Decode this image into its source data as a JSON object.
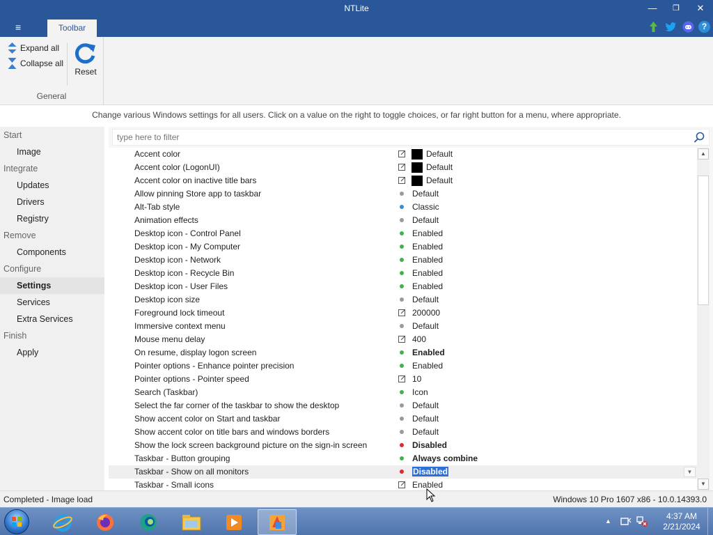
{
  "window": {
    "title": "NTLite",
    "minimize": "—",
    "restore": "❐",
    "close": "✕"
  },
  "ribbon": {
    "menu_icon": "≡",
    "tab_label": "Toolbar",
    "expand_all": "Expand all",
    "collapse_all": "Collapse all",
    "reset": "Reset",
    "group_label": "General",
    "header_icons": [
      "update-arrow-icon",
      "twitter-icon",
      "discord-icon",
      "help-icon"
    ],
    "help": "?"
  },
  "info_text": "Change various Windows settings for all users. Click on a value on the right to toggle choices, or far right button for a menu, where appropriate.",
  "sidebar": {
    "items": [
      {
        "label": "Start",
        "kind": "cat"
      },
      {
        "label": "Image",
        "kind": "sub"
      },
      {
        "label": "Integrate",
        "kind": "cat"
      },
      {
        "label": "Updates",
        "kind": "sub"
      },
      {
        "label": "Drivers",
        "kind": "sub"
      },
      {
        "label": "Registry",
        "kind": "sub"
      },
      {
        "label": "Remove",
        "kind": "cat"
      },
      {
        "label": "Components",
        "kind": "sub"
      },
      {
        "label": "Configure",
        "kind": "cat"
      },
      {
        "label": "Settings",
        "kind": "sub",
        "active": true
      },
      {
        "label": "Services",
        "kind": "sub"
      },
      {
        "label": "Extra Services",
        "kind": "sub"
      },
      {
        "label": "Finish",
        "kind": "cat"
      },
      {
        "label": "Apply",
        "kind": "sub"
      }
    ]
  },
  "filter": {
    "placeholder": "type here to filter"
  },
  "settings": [
    {
      "name": "Accent color",
      "indicator": "edit",
      "swatch": true,
      "value": "Default"
    },
    {
      "name": "Accent color (LogonUI)",
      "indicator": "edit",
      "swatch": true,
      "value": "Default"
    },
    {
      "name": "Accent color on inactive title bars",
      "indicator": "edit",
      "swatch": true,
      "value": "Default"
    },
    {
      "name": "Allow pinning Store app to taskbar",
      "indicator": "gray",
      "value": "Default"
    },
    {
      "name": "Alt-Tab style",
      "indicator": "blue",
      "value": "Classic"
    },
    {
      "name": "Animation effects",
      "indicator": "gray",
      "value": "Default"
    },
    {
      "name": "Desktop icon - Control Panel",
      "indicator": "green",
      "value": "Enabled"
    },
    {
      "name": "Desktop icon - My Computer",
      "indicator": "green",
      "value": "Enabled"
    },
    {
      "name": "Desktop icon - Network",
      "indicator": "green",
      "value": "Enabled"
    },
    {
      "name": "Desktop icon - Recycle Bin",
      "indicator": "green",
      "value": "Enabled"
    },
    {
      "name": "Desktop icon - User Files",
      "indicator": "green",
      "value": "Enabled"
    },
    {
      "name": "Desktop icon size",
      "indicator": "gray",
      "value": "Default"
    },
    {
      "name": "Foreground lock timeout",
      "indicator": "edit",
      "value": "200000"
    },
    {
      "name": "Immersive context menu",
      "indicator": "gray",
      "value": "Default"
    },
    {
      "name": "Mouse menu delay",
      "indicator": "edit",
      "value": "400"
    },
    {
      "name": "On resume, display logon screen",
      "indicator": "green",
      "value": "Enabled",
      "bold": true
    },
    {
      "name": "Pointer options - Enhance pointer precision",
      "indicator": "green",
      "value": "Enabled"
    },
    {
      "name": "Pointer options - Pointer speed",
      "indicator": "edit",
      "value": "10"
    },
    {
      "name": "Search (Taskbar)",
      "indicator": "green",
      "value": "Icon"
    },
    {
      "name": "Select the far corner of the taskbar to show the desktop",
      "indicator": "gray",
      "value": "Default"
    },
    {
      "name": "Show accent color on Start and taskbar",
      "indicator": "gray",
      "value": "Default"
    },
    {
      "name": "Show accent color on title bars and windows borders",
      "indicator": "gray",
      "value": "Default"
    },
    {
      "name": "Show the lock screen background picture on the sign-in screen",
      "indicator": "red",
      "value": "Disabled",
      "bold": true
    },
    {
      "name": "Taskbar - Button grouping",
      "indicator": "green",
      "value": "Always combine",
      "bold": true
    },
    {
      "name": "Taskbar - Show on all monitors",
      "indicator": "red",
      "value": "Disabled",
      "bold": true,
      "selected": true,
      "dropdown": true
    },
    {
      "name": "Taskbar - Small icons",
      "indicator": "edit",
      "value": "Enabled"
    }
  ],
  "colors": {
    "titlebar": "#2a579a",
    "green": "#3eb34d",
    "gray": "#9a9a9a",
    "blue": "#2f8fd6",
    "red": "#e0282e",
    "selection": "#2f6fd6"
  },
  "status": {
    "left": "Completed - Image load",
    "right": "Windows 10 Pro 1607 x86 - 10.0.14393.0"
  },
  "taskbar": {
    "apps": [
      "internet-explorer-icon",
      "firefox-icon",
      "edge-icon",
      "file-explorer-icon",
      "media-player-icon",
      "ntlite-icon"
    ],
    "time": "4:37 AM",
    "date": "2/21/2024"
  }
}
